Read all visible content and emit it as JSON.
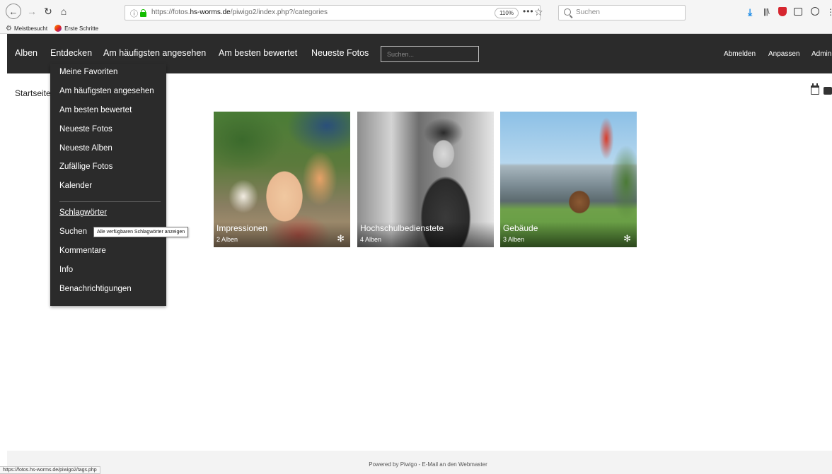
{
  "browser": {
    "url_prefix": "https://fotos.",
    "url_host": "hs-worms.de",
    "url_path": "/piwigo2/index.php?/categories",
    "zoom": "110%",
    "more": "•••",
    "search_placeholder": "Suchen",
    "bookmarks": [
      {
        "label": "Meistbesucht"
      },
      {
        "label": "Erste Schritte"
      }
    ],
    "status_url": "https://fotos.hs-worms.de/piwigo2/tags.php"
  },
  "site": {
    "menu": [
      "Alben",
      "Entdecken",
      "Am häufigsten angesehen",
      "Am besten bewertet",
      "Neueste Fotos"
    ],
    "search_placeholder": "Suchen...",
    "right_menu": [
      "Abmelden",
      "Anpassen",
      "Admin"
    ],
    "breadcrumb": "Startseite"
  },
  "albums": [
    {
      "name": "Impressionen",
      "count": "2 Alben",
      "star": "✻"
    },
    {
      "name": "Hochschulbedienstete",
      "count": "4 Alben",
      "star": ""
    },
    {
      "name": "Gebäude",
      "count": "3 Alben",
      "star": "✻"
    }
  ],
  "dropdown": {
    "items": [
      "Meine Favoriten",
      "Am häufigsten angesehen",
      "Am besten bewertet",
      "Neueste Fotos",
      "Neueste Alben",
      "Zufällige Fotos",
      "Kalender",
      "Schlagwörter",
      "Suchen",
      "Kommentare",
      "Info",
      "Benachrichtigungen"
    ],
    "tooltip": "Alle verfügbaren Schlagwörter anzeigen"
  },
  "footer": {
    "text": "Powered by Piwigo - E-Mail an den Webmaster"
  }
}
